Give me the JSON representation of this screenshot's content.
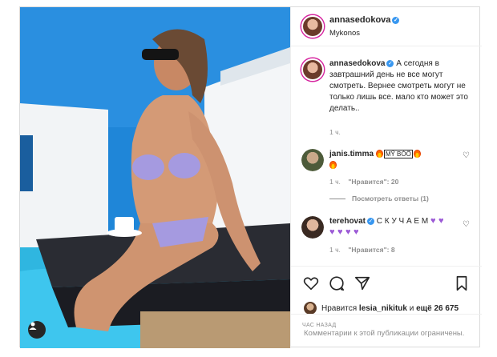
{
  "post": {
    "author": "annasedokova",
    "location": "Mykonos",
    "verified_mark": "✓",
    "caption_author": "annasedokova",
    "caption": "А сегодня в завтрашний день не все могут смотреть. Вернее смотреть могут не только лишь все. мало кто может это делать..",
    "caption_time": "1 ч."
  },
  "comments": [
    {
      "author": "janis.timma",
      "text_box": "MỸ BÒÖ",
      "time": "1 ч.",
      "likes": "\"Нравится\": 20",
      "view_replies": "Посмотреть ответы (1)"
    },
    {
      "author": "terehovat",
      "text": "С К У Ч А Е М",
      "time": "1 ч.",
      "likes": "\"Нравится\": 8"
    }
  ],
  "likes_line": {
    "prefix": "Нравится",
    "user": "lesia_nikituk",
    "middle": "и",
    "count": "ещё 26 675"
  },
  "time_ago": "ЧАС НАЗАД",
  "footer_note": "Комментарии к этой публикации ограничены.",
  "colors": {
    "verified": "#3897f0",
    "border": "#dbdbdb",
    "muted": "#8e8e8e",
    "sky": "#1f86d8",
    "pool": "#2fb6e0"
  },
  "icons": [
    "heart-icon",
    "comment-icon",
    "share-icon",
    "bookmark-icon",
    "user-tag-icon",
    "fire-emoji",
    "purple-heart-emoji"
  ]
}
